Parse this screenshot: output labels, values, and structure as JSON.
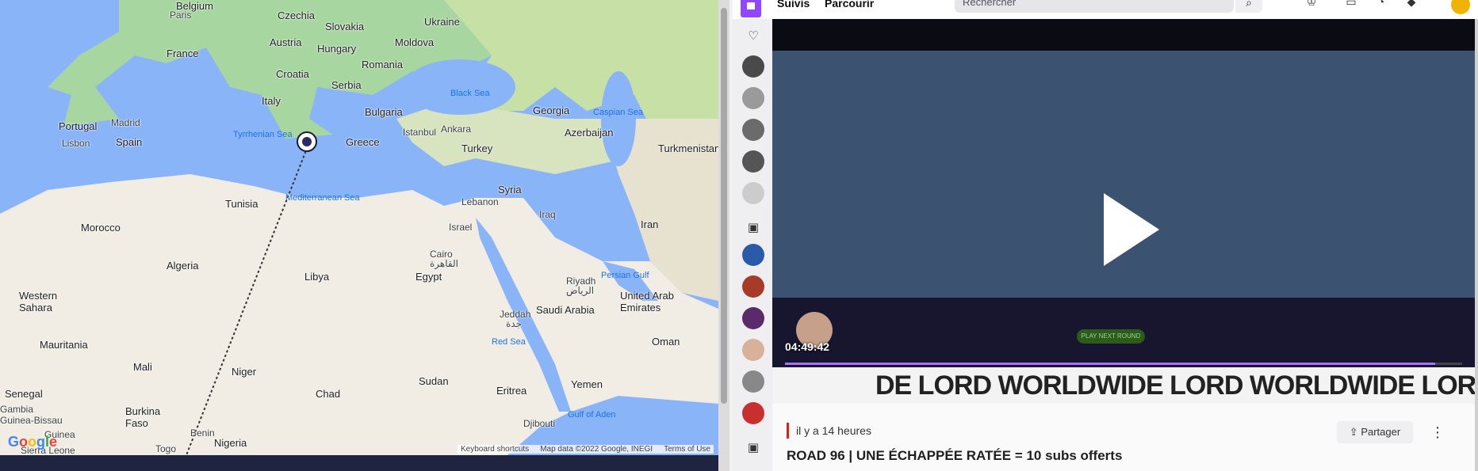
{
  "map": {
    "countries": [
      "Belgium",
      "Paris",
      "Czechia",
      "Slovakia",
      "Ukraine",
      "Austria",
      "Hungary",
      "Moldova",
      "France",
      "Croatia",
      "Romania",
      "Italy",
      "Serbia",
      "Bulgaria",
      "Portugal",
      "Madrid",
      "Spain",
      "Lisbon",
      "Greece",
      "Istanbul",
      "Ankara",
      "Turkey",
      "Georgia",
      "Azerbaijan",
      "Turkmenistan",
      "Tunisia",
      "Syria",
      "Lebanon",
      "Iraq",
      "Israel",
      "Iran",
      "Morocco",
      "Algeria",
      "Libya",
      "Cairo",
      "القاهرة",
      "Egypt",
      "Riyadh",
      "الرياض",
      "Persian Gulf",
      "United Arab Emirates",
      "Saudi Arabia",
      "Jeddah",
      "جدة",
      "Western Sahara",
      "Mauritania",
      "Mali",
      "Niger",
      "Chad",
      "Sudan",
      "Eritrea",
      "Yemen",
      "Oman",
      "Red Sea",
      "Senegal",
      "Gambia",
      "Guinea-Bissau",
      "Guinea",
      "Burkina Faso",
      "Benin",
      "Nigeria",
      "Djibouti",
      "Gulf of Aden",
      "Togo",
      "Sierra Leone"
    ],
    "seas": [
      "Black Sea",
      "Tyrrhenian Sea",
      "Mediterranean Sea",
      "Caspian Sea"
    ],
    "attribution": [
      "Keyboard shortcuts",
      "Map data ©2022 Google, INEGI",
      "Terms of Use"
    ],
    "google_logo": [
      "G",
      "o",
      "o",
      "g",
      "l",
      "e"
    ]
  },
  "twitch": {
    "nav": {
      "following": "Suivis",
      "browse": "Parcourir",
      "search_placeholder": "Rechercher"
    },
    "player": {
      "timestamp": "04:49:42",
      "play_next": "PLAY NEXT ROUND",
      "progress_fraction": 0.96
    },
    "banner_text": "DE LORD WORLDWIDE LORD WORLDWIDE LORD WORLDW",
    "info": {
      "time_ago": "il y a 14 heures",
      "title": "ROAD 96 | UNE ÉCHAPPÉE RATÉE = 10 subs offerts",
      "share_label": "Partager",
      "more": "⋮"
    },
    "colors": {
      "accent": "#9146ff",
      "live": "#e91916",
      "progress": "#a970ff"
    }
  }
}
